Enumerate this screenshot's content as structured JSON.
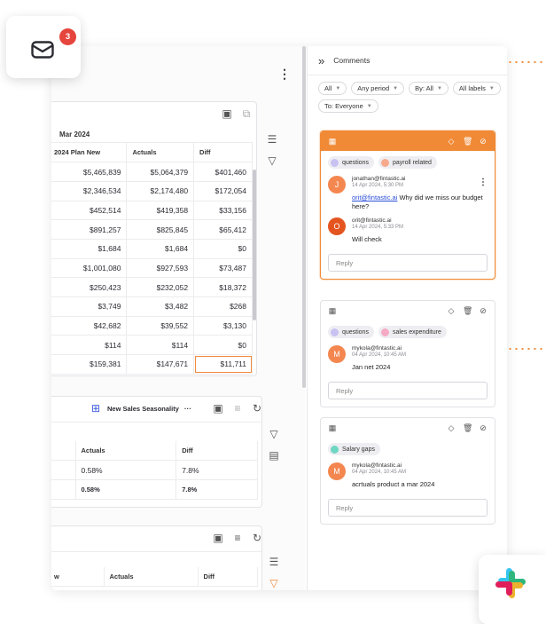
{
  "notifications": {
    "count": "3",
    "icon": "mail-icon"
  },
  "top_table": {
    "period": "Mar 2024",
    "columns": [
      "2024 Plan New",
      "Actuals",
      "Diff"
    ],
    "rows": [
      [
        "$5,465,839",
        "$5,064,379",
        "$401,460"
      ],
      [
        "$2,346,534",
        "$2,174,480",
        "$172,054"
      ],
      [
        "$452,514",
        "$419,358",
        "$33,156"
      ],
      [
        "$891,257",
        "$825,845",
        "$65,412"
      ],
      [
        "$1,684",
        "$1,684",
        "$0"
      ],
      [
        "$1,001,080",
        "$927,593",
        "$73,487"
      ],
      [
        "$250,423",
        "$232,052",
        "$18,372"
      ],
      [
        "$3,749",
        "$3,482",
        "$268"
      ],
      [
        "$42,682",
        "$39,552",
        "$3,130"
      ],
      [
        "$114",
        "$114",
        "$0"
      ],
      [
        "$159,381",
        "$147,671",
        "$11,711"
      ]
    ]
  },
  "middle_widget": {
    "title": "New Sales Seasonality",
    "more": "···",
    "columns": [
      "Actuals",
      "Diff"
    ],
    "rows": [
      [
        "0.58%",
        "7.8%"
      ],
      [
        "0.58%",
        "7.8%"
      ]
    ]
  },
  "bottom_widget": {
    "columns": [
      "w",
      "Actuals",
      "Diff"
    ]
  },
  "comments": {
    "header": "Comments",
    "filters": [
      {
        "label": "All"
      },
      {
        "label": "Any period"
      },
      {
        "label": "By: All"
      },
      {
        "label": "All labels"
      },
      {
        "label": "To: Everyone"
      }
    ],
    "reply_placeholder": "Reply",
    "threads": [
      {
        "tags": [
          {
            "label": "questions",
            "color": "#c8c2f2"
          },
          {
            "label": "payroll related",
            "color": "#f7a98c"
          }
        ],
        "messages": [
          {
            "initial": "J",
            "color": "#f4874f",
            "author": "jonathan@fintastic.ai",
            "time": "14 Apr 2024, 5:30 PM",
            "mention": "orit@fintastic.ai",
            "text": " Why did we miss our budget here?"
          },
          {
            "initial": "O",
            "color": "#e4541f",
            "author": "orit@fintastic.ai",
            "time": "14 Apr 2024, 5:33 PM",
            "text": "Will check"
          }
        ]
      },
      {
        "tags": [
          {
            "label": "questions",
            "color": "#c8c2f2"
          },
          {
            "label": "sales expenditure",
            "color": "#f6a9c4"
          }
        ],
        "messages": [
          {
            "initial": "M",
            "color": "#f4874f",
            "author": "mykola@fintastic.ai",
            "time": "04 Apr 2024, 10:45 AM",
            "text": "Jan net 2024"
          }
        ]
      },
      {
        "tags": [
          {
            "label": "Salary gaps",
            "color": "#6fd6c1"
          }
        ],
        "messages": [
          {
            "initial": "M",
            "color": "#f4874f",
            "author": "mykola@fintastic.ai",
            "time": "04 Apr 2024, 10:45 AM",
            "text": "acrtuals product a mar 2024"
          }
        ]
      }
    ]
  },
  "colors": {
    "accent": "#f08a36",
    "badge": "#e5453c",
    "link": "#2a4fd6"
  }
}
